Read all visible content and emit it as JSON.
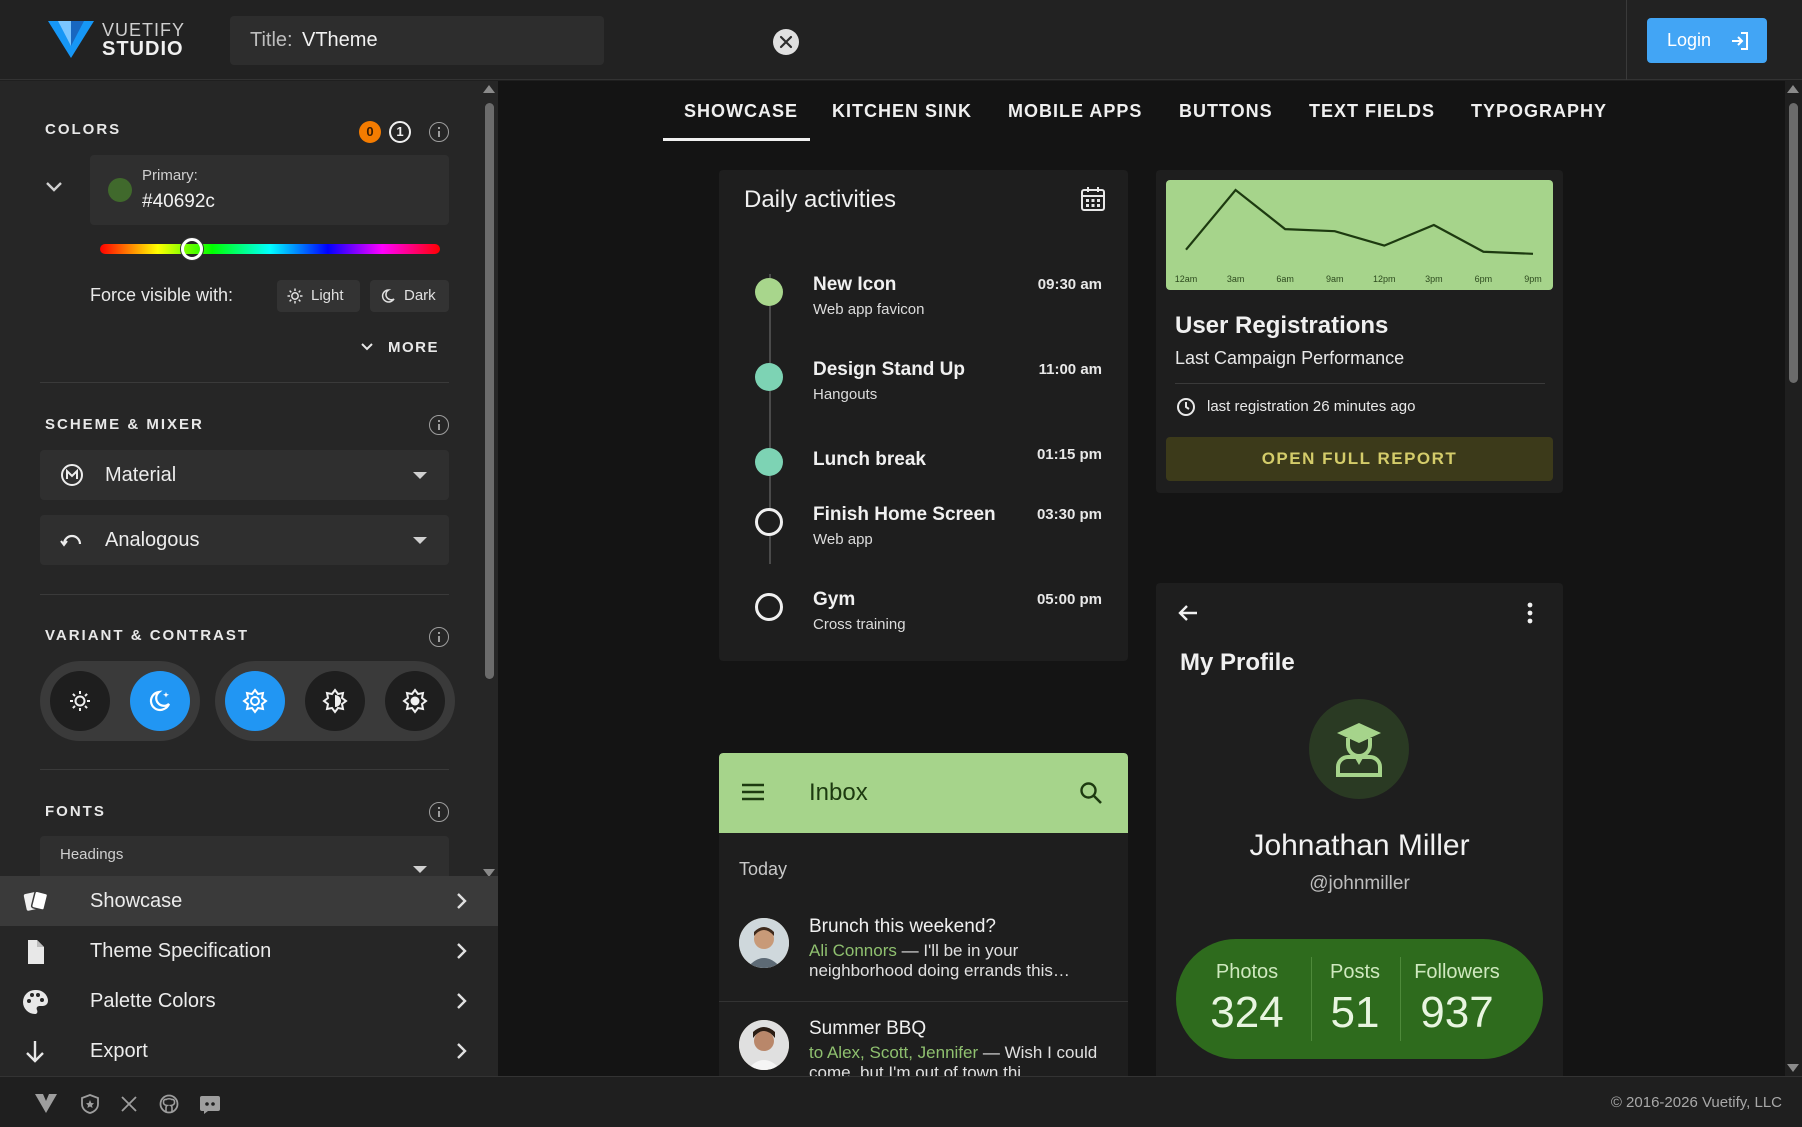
{
  "header": {
    "logo_line1": "VUETIFY",
    "logo_line2": "STUDIO",
    "title_label": "Title:",
    "title_value": "VTheme",
    "login_label": "Login"
  },
  "sidebar": {
    "colors": {
      "title": "COLORS",
      "badge_count": "0",
      "badge_index": "1",
      "primary_label": "Primary:",
      "primary_value": "#40692c",
      "hue_percent": 27,
      "force_label": "Force visible with:",
      "light_label": "Light",
      "dark_label": "Dark",
      "more_label": "MORE"
    },
    "scheme": {
      "title": "SCHEME & MIXER",
      "scheme_value": "Material",
      "mixer_value": "Analogous"
    },
    "variant": {
      "title": "VARIANT & CONTRAST",
      "active_variant": "dark",
      "active_contrast": "standard"
    },
    "fonts": {
      "title": "FONTS",
      "headings_label": "Headings"
    },
    "nav": [
      {
        "label": "Showcase",
        "icon": "cards-icon",
        "active": true
      },
      {
        "label": "Theme Specification",
        "icon": "file-icon",
        "active": false
      },
      {
        "label": "Palette Colors",
        "icon": "palette-icon",
        "active": false
      },
      {
        "label": "Export",
        "icon": "arrow-down-icon",
        "active": false
      }
    ]
  },
  "tabs": [
    "SHOWCASE",
    "KITCHEN SINK",
    "MOBILE APPS",
    "BUTTONS",
    "TEXT FIELDS",
    "TYPOGRAPHY"
  ],
  "daily": {
    "title": "Daily activities",
    "items": [
      {
        "name": "New Icon",
        "sub": "Web app favicon",
        "time": "09:30 am"
      },
      {
        "name": "Design Stand Up",
        "sub": "Hangouts",
        "time": "11:00 am"
      },
      {
        "name": "Lunch break",
        "sub": "",
        "time": "01:15 pm"
      },
      {
        "name": "Finish Home Screen",
        "sub": "Web app",
        "time": "03:30 pm"
      },
      {
        "name": "Gym",
        "sub": "Cross training",
        "time": "05:00 pm"
      }
    ]
  },
  "registrations": {
    "title": "User Registrations",
    "subtitle": "Last Campaign Performance",
    "last": "last registration 26 minutes ago",
    "button": "OPEN FULL REPORT",
    "chart_data": {
      "type": "line",
      "categories": [
        "12am",
        "3am",
        "6am",
        "9am",
        "12pm",
        "3pm",
        "6pm",
        "9pm"
      ],
      "values": [
        10,
        68,
        30,
        28,
        14,
        34,
        8,
        6
      ]
    }
  },
  "inbox": {
    "title": "Inbox",
    "today": "Today",
    "messages": [
      {
        "title": "Brunch this weekend?",
        "from": "Ali Connors",
        "body": " — I'll be in your neighborhood doing errands this…"
      },
      {
        "title": "Summer BBQ",
        "from": "to Alex, Scott, Jennifer",
        "body": " — Wish I could come, but I'm out of town thi…"
      }
    ]
  },
  "profile": {
    "title": "My Profile",
    "name": "Johnathan Miller",
    "handle": "@johnmiller",
    "stats": [
      {
        "label": "Photos",
        "value": "324"
      },
      {
        "label": "Posts",
        "value": "51"
      },
      {
        "label": "Followers",
        "value": "937"
      }
    ]
  },
  "footer": {
    "copyright": "© 2016-2026 Vuetify, LLC"
  },
  "colors": {
    "primary": "#40692c",
    "accent": "#2196f3",
    "login": "#42a5f5",
    "card_green": "#a6d48b"
  }
}
